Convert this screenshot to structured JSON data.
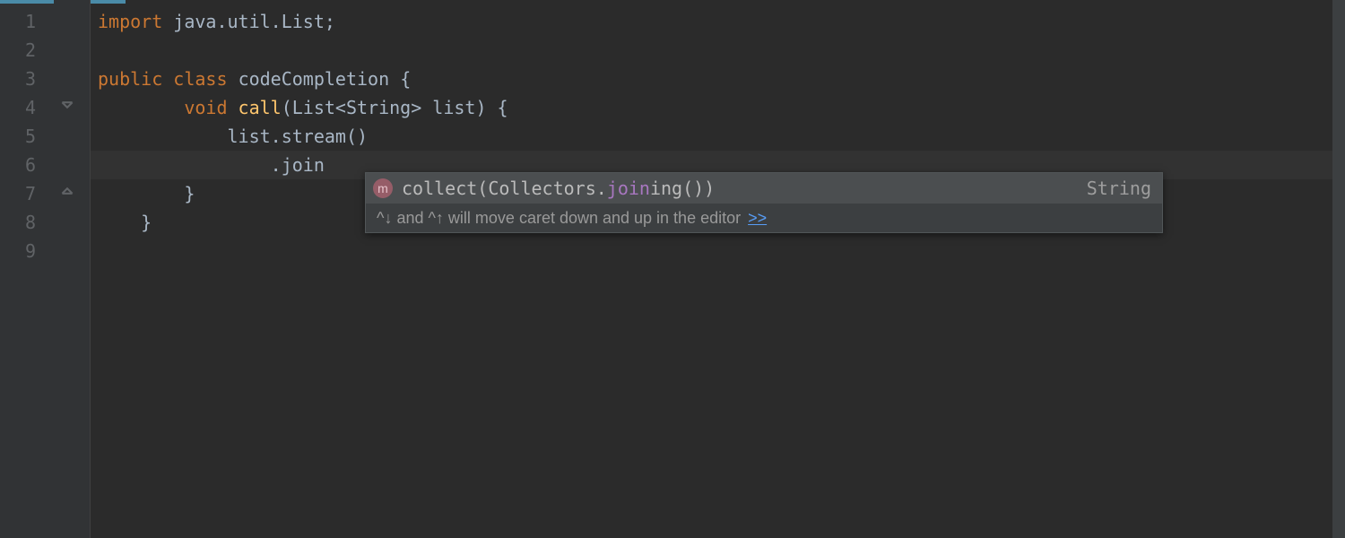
{
  "gutter": {
    "lines": [
      "1",
      "2",
      "3",
      "4",
      "5",
      "6",
      "7",
      "8",
      "9"
    ]
  },
  "code": {
    "line1": {
      "kw": "import",
      "rest": " java.util.List;"
    },
    "line3": {
      "kw1": "public",
      "kw2": "class",
      "cls": "codeCompletion ",
      "brace": "{"
    },
    "line4": {
      "kw": "void",
      "fn": "call",
      "params": "(List<String> list) {"
    },
    "line5": "            list.stream()",
    "line6_prefix": "                .",
    "line6_join": "join",
    "line7": "        }",
    "line8": "    }"
  },
  "completion": {
    "icon": "m",
    "prefix": "collect(Collectors.",
    "match": "join",
    "suffix": "ing())",
    "return_type": "String",
    "hint": "^↓ and ^↑ will move caret down and up in the editor",
    "hint_link": ">>"
  }
}
